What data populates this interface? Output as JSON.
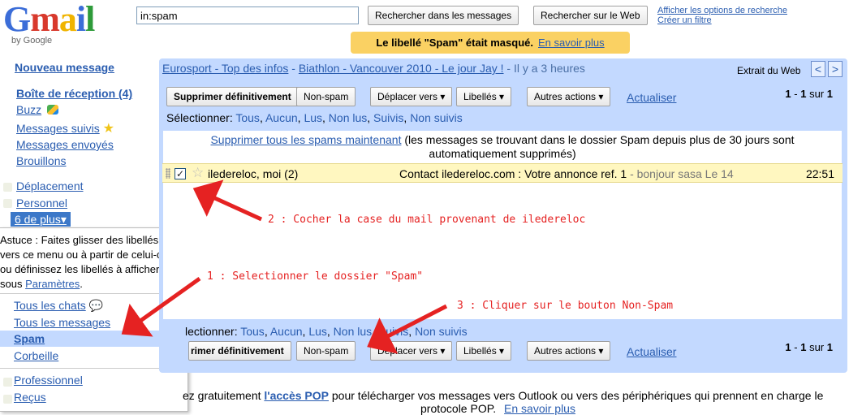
{
  "header": {
    "logo_word": "Gmail",
    "logo_sub": "by Google",
    "search_value": "in:spam",
    "search_mail_label": "Rechercher dans les messages",
    "search_web_label": "Rechercher sur le Web",
    "show_options": "Afficher les options de recherche",
    "create_filter": "Créer un filtre",
    "notice_text": "Le libellé \"Spam\" était masqué.",
    "notice_link": "En savoir plus"
  },
  "sidebar": {
    "compose": "Nouveau message",
    "inbox": "Boîte de réception (4)",
    "buzz": "Buzz",
    "starred": "Messages suivis",
    "sent": "Messages envoyés",
    "drafts": "Brouillons",
    "label1": "Déplacement",
    "label2": "Personnel",
    "more": "6 de plus▾",
    "dropdown": {
      "tip_line1": "Astuce : Faites glisser des libellés",
      "tip_line2": "vers ce menu ou à partir de celui-ci,",
      "tip_line3": "ou définissez les libellés à afficher",
      "tip_line4_prefix": "sous",
      "tip_line4_link": "Paramètres",
      "tip_line4_suffix": ".",
      "all_chats": "Tous les chats",
      "all_mail": "Tous les messages",
      "spam": "Spam",
      "trash": "Corbeille",
      "professional": "Professionnel",
      "received": "Reçus"
    }
  },
  "news": {
    "source": "Eurosport - Top des infos",
    "separator": "-",
    "headline": "Biathlon - Vancouver 2010 - Le jour Jay !",
    "time": "- Il y a 3 heures",
    "web_clip": "Extrait du Web",
    "prev": "<",
    "next": ">"
  },
  "toolbar": {
    "delete_forever": "Supprimer définitivement",
    "not_spam": "Non-spam",
    "move_to": "Déplacer vers ▾",
    "labels": "Libellés ▾",
    "more_actions": "Autres actions ▾",
    "refresh": "Actualiser",
    "pager_a": "1",
    "pager_b": "1",
    "pager_of": "sur",
    "pager_total": "1",
    "select_label": "Sélectionner:",
    "select_all": "Tous",
    "select_none": "Aucun",
    "select_read": "Lus",
    "select_unread": "Non lus",
    "select_starred": "Suivis",
    "select_unstarred": "Non suivis"
  },
  "purge": {
    "link": "Supprimer tous les spams maintenant",
    "line1_rest": "(les messages se trouvant dans le dossier Spam depuis plus de 30 jours sont",
    "line2": "automatiquement supprimés)"
  },
  "messages": [
    {
      "sender": "iledereloc, moi (2)",
      "subject": "Contact iledereloc.com : Votre annonce ref. 1",
      "snippet": "- bonjour sasa Le 14",
      "time": "22:51",
      "checked": "✓"
    }
  ],
  "bottom": {
    "select_label": "lectionner:",
    "delete_forever": "rimer définitivement"
  },
  "footer": {
    "prefix": "ez gratuitement",
    "pop_link": "l'accès POP",
    "rest": "pour télécharger vos messages vers Outlook ou vers des périphériques qui prennent en charge le",
    "line2": "protocole POP.",
    "learn_more": "En savoir plus"
  },
  "annotations": {
    "step2": "2 : Cocher la case du mail provenant de iledereloc",
    "step1": "1 : Selectionner le dossier \"Spam\"",
    "step3": "3 : Cliquer sur le bouton Non-Spam"
  },
  "colors": {
    "panel": "#c3d9ff",
    "notice": "#fad163",
    "message_row": "#fff7c0",
    "annotation_red": "#e52222",
    "link": "#2a5db0"
  }
}
